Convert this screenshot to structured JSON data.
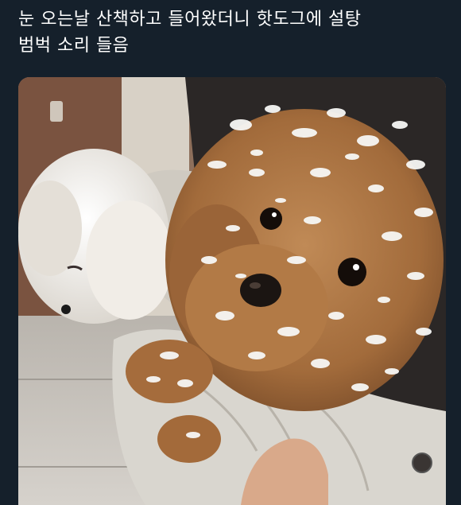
{
  "post": {
    "text_line1": "눈 오는날 산책하고 들어왔더니 핫도그에 설탕",
    "text_line2": "범벅 소리 들음"
  },
  "photo": {
    "subject": "two snow-covered poodles being carried in a knit bag"
  },
  "colors": {
    "background": "#15202b",
    "text": "#ffffff",
    "fur_brown": "#a8703f",
    "fur_white": "#eeeae4",
    "snow": "#f7f7f5",
    "bag": "#d9d6cf"
  }
}
